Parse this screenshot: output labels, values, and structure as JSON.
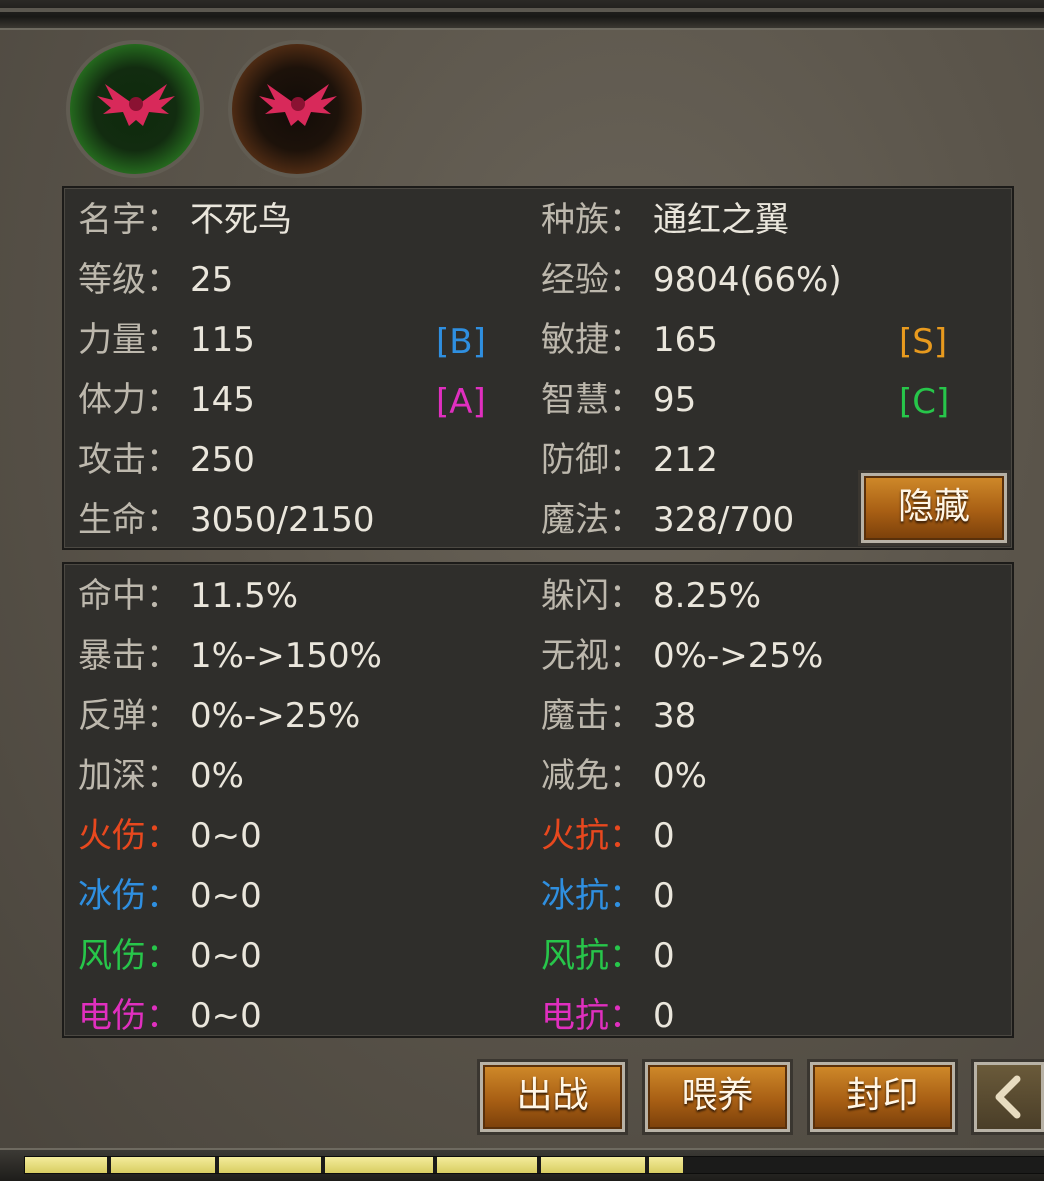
{
  "pets": [
    {
      "name_icon": "phoenix-icon",
      "frame_color": "#3b9a2e",
      "selected": true
    },
    {
      "name_icon": "phoenix-icon",
      "frame_color": "#7a4420",
      "selected": false
    }
  ],
  "basic": {
    "name": {
      "label": "名字：",
      "value": "不死鸟"
    },
    "race": {
      "label": "种族：",
      "value": "通红之翼"
    },
    "level": {
      "label": "等级：",
      "value": "25"
    },
    "exp": {
      "label": "经验：",
      "value": "9804(66%)"
    },
    "strength": {
      "label": "力量：",
      "value": "115",
      "grade": "[B]",
      "grade_color": "#2f8fe0"
    },
    "agility": {
      "label": "敏捷：",
      "value": "165",
      "grade": "[S]",
      "grade_color": "#e89a1e"
    },
    "stamina": {
      "label": "体力：",
      "value": "145",
      "grade": "[A]",
      "grade_color": "#e02fbf"
    },
    "wisdom": {
      "label": "智慧：",
      "value": "95",
      "grade": "[C]",
      "grade_color": "#27c64a"
    },
    "attack": {
      "label": "攻击：",
      "value": "250"
    },
    "defense": {
      "label": "防御：",
      "value": "212"
    },
    "hp": {
      "label": "生命：",
      "value": "3050/2150"
    },
    "mp": {
      "label": "魔法：",
      "value": "328/700"
    },
    "hide_button": "隐藏"
  },
  "combat": [
    {
      "l_label": "命中：",
      "l_value": "11.5%",
      "l_color": "#bdb8ad",
      "r_label": "躲闪：",
      "r_value": "8.25%",
      "r_color": "#bdb8ad"
    },
    {
      "l_label": "暴击：",
      "l_value": "1%->150%",
      "l_color": "#bdb8ad",
      "r_label": "无视：",
      "r_value": "0%->25%",
      "r_color": "#bdb8ad"
    },
    {
      "l_label": "反弹：",
      "l_value": "0%->25%",
      "l_color": "#bdb8ad",
      "r_label": "魔击：",
      "r_value": "38",
      "r_color": "#bdb8ad"
    },
    {
      "l_label": "加深：",
      "l_value": "0%",
      "l_color": "#bdb8ad",
      "r_label": "减免：",
      "r_value": "0%",
      "r_color": "#bdb8ad"
    },
    {
      "l_label": "火伤：",
      "l_value": "0~0",
      "l_color": "#e8481e",
      "r_label": "火抗：",
      "r_value": "0",
      "r_color": "#e8481e"
    },
    {
      "l_label": "冰伤：",
      "l_value": "0~0",
      "l_color": "#2f8fe0",
      "r_label": "冰抗：",
      "r_value": "0",
      "r_color": "#2f8fe0"
    },
    {
      "l_label": "风伤：",
      "l_value": "0~0",
      "l_color": "#27c64a",
      "r_label": "风抗：",
      "r_value": "0",
      "r_color": "#27c64a"
    },
    {
      "l_label": "电伤：",
      "l_value": "0~0",
      "l_color": "#e02fbf",
      "r_label": "电抗：",
      "r_value": "0",
      "r_color": "#e02fbf"
    }
  ],
  "actions": {
    "battle": "出战",
    "feed": "喂养",
    "seal": "封印",
    "back_icon": "chevron-left-icon"
  },
  "exp_bar": {
    "progress": 0.645
  }
}
